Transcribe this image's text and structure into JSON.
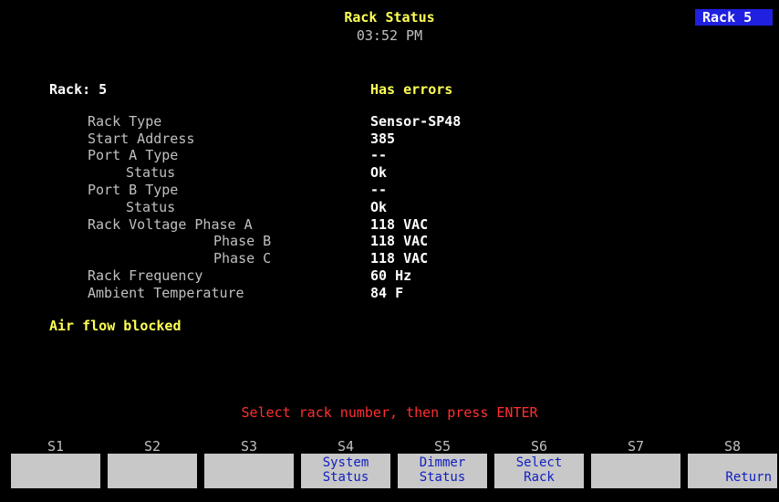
{
  "header": {
    "title": "Rack Status",
    "time": "03:52 PM",
    "rack_badge": "Rack 5"
  },
  "rack": {
    "label": "Rack: 5",
    "state": "Has errors"
  },
  "fields": [
    {
      "label": "Rack Type",
      "value": "Sensor-SP48"
    },
    {
      "label": "Start Address",
      "value": "385"
    },
    {
      "label": "Port A Type",
      "value": "--"
    },
    {
      "label": "Status",
      "value": "Ok"
    },
    {
      "label": "Port B Type",
      "value": "--"
    },
    {
      "label": "Status",
      "value": "Ok"
    },
    {
      "label": "Rack Voltage Phase A",
      "value": "118 VAC"
    },
    {
      "label": "Phase B",
      "value": "118 VAC"
    },
    {
      "label": "Phase C",
      "value": "118 VAC"
    },
    {
      "label": "Rack Frequency",
      "value": "60 Hz"
    },
    {
      "label": "Ambient Temperature",
      "value": "84 F"
    }
  ],
  "alert": "Air flow blocked",
  "prompt": "Select rack number, then press ENTER",
  "softkeys": [
    {
      "num": "S1",
      "line1": "",
      "line2": ""
    },
    {
      "num": "S2",
      "line1": "",
      "line2": ""
    },
    {
      "num": "S3",
      "line1": "",
      "line2": ""
    },
    {
      "num": "S4",
      "line1": "System",
      "line2": "Status"
    },
    {
      "num": "S5",
      "line1": "Dimmer",
      "line2": "Status"
    },
    {
      "num": "S6",
      "line1": "Select",
      "line2": "Rack"
    },
    {
      "num": "S7",
      "line1": "",
      "line2": ""
    },
    {
      "num": "S8",
      "line1": "",
      "line2": "Return"
    }
  ],
  "colors": {
    "background": "#000000",
    "header_text": "#ffff55",
    "badge_bg": "#2020e0",
    "prompt_text": "#ff3030",
    "softkey_bg": "#c8c8c8",
    "softkey_text": "#1020c0"
  }
}
